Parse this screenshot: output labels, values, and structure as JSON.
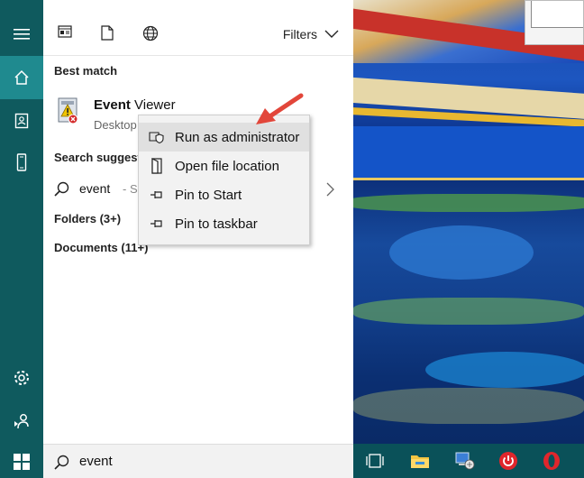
{
  "left_strip": {
    "icons": [
      "hamburger-icon",
      "home-icon",
      "notebook-icon",
      "phone-icon",
      "settings-icon",
      "feedback-icon",
      "windows-start-icon"
    ]
  },
  "toolbar": {
    "icons": [
      "apps-icon",
      "documents-icon",
      "web-icon"
    ],
    "filters_label": "Filters"
  },
  "best_match": {
    "section_title": "Best match",
    "app_name_bold": "Event",
    "app_name_rest": " Viewer",
    "app_type": "Desktop"
  },
  "suggestions": {
    "section_title": "Search suggesti",
    "query": "event",
    "more": "- See"
  },
  "folders": {
    "label": "Folders (3+)"
  },
  "documents": {
    "label": "Documents (11+)"
  },
  "context_menu": {
    "items": [
      {
        "label": "Run as administrator",
        "icon": "shield-icon",
        "highlighted": true
      },
      {
        "label": "Open file location",
        "icon": "folder-open-icon",
        "highlighted": false
      },
      {
        "label": "Pin to Start",
        "icon": "pin-icon",
        "highlighted": false
      },
      {
        "label": "Pin to taskbar",
        "icon": "pin-icon",
        "highlighted": false
      }
    ]
  },
  "search": {
    "value": "event"
  },
  "colors": {
    "strip": "#0f5a5e",
    "strip_active": "#1f8a8f",
    "arrow": "#e2463a",
    "taskbar": "#0a5159"
  }
}
